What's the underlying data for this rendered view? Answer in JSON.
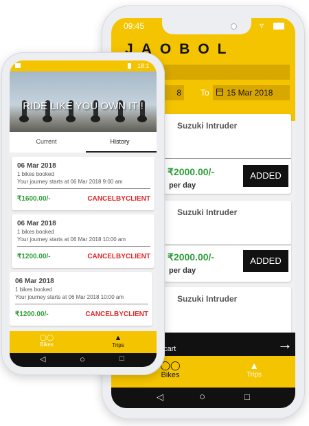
{
  "accent_color": "#f5c400",
  "green_color": "#2e9e3a",
  "red_color": "#e02424",
  "back_phone": {
    "status": {
      "time": "09:45"
    },
    "logo": "JAOBOL",
    "date_from": "8",
    "to_label": "To",
    "date_to": "15 Mar 2018",
    "bikes": [
      {
        "name": "Suzuki Intruder",
        "price": "₹2000.00/-",
        "per": "per day",
        "button": "ADDED"
      },
      {
        "name": "Suzuki Intruder",
        "price": "₹2000.00/-",
        "per": "per day",
        "button": "ADDED"
      },
      {
        "name": "Suzuki Intruder"
      }
    ],
    "cart_label": "cart",
    "nav": {
      "bikes": "Bikes",
      "trips": "Trips"
    }
  },
  "front_phone": {
    "status": {
      "time": "18:1"
    },
    "hero_title": "RIDE LIKE YOU OWN IT!!",
    "tabs": {
      "current": "Current",
      "history": "History"
    },
    "trips": [
      {
        "date": "06 Mar 2018",
        "booked": "1 bikes booked",
        "journey": "Your journey starts at 06 Mar 2018 9:00 am",
        "amount": "₹1600.00/-",
        "status": "CANCELBYCLIENT"
      },
      {
        "date": "06 Mar 2018",
        "booked": "1 bikes booked",
        "journey": "Your journey starts at 06 Mar 2018 10:00 am",
        "amount": "₹1200.00/-",
        "status": "CANCELBYCLIENT"
      },
      {
        "date": "06 Mar 2018",
        "booked": "1 bikes booked",
        "journey": "Your journey starts at 06 Mar 2018 10:00 am",
        "amount": "₹1200.00/-",
        "status": "CANCELBYCLIENT"
      }
    ],
    "nav": {
      "bikes": "Bikes",
      "trips": "Trips"
    }
  },
  "icons": [
    "wifi-icon",
    "battery-icon",
    "calendar-icon",
    "arrow-right-icon",
    "bicycle-icon",
    "navigation-icon",
    "back-icon",
    "home-icon",
    "recents-icon"
  ]
}
